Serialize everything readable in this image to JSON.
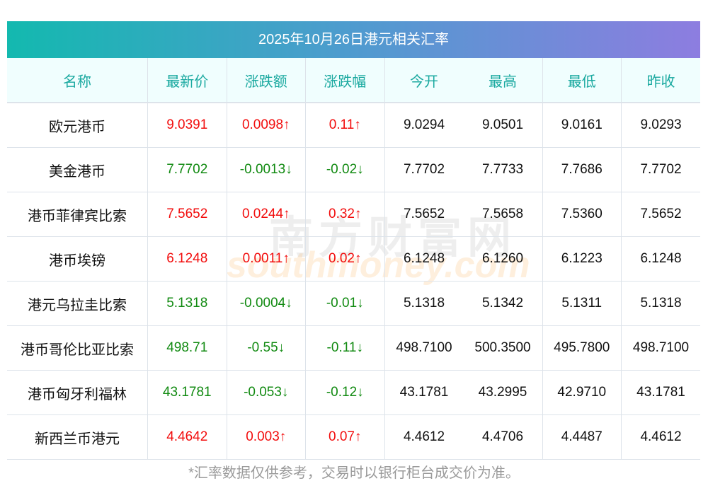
{
  "title": "2025年10月26日港元相关汇率",
  "headers": [
    "名称",
    "最新价",
    "涨跌额",
    "涨跌幅",
    "今开",
    "最高",
    "最低",
    "昨收"
  ],
  "rows": [
    {
      "name": "欧元港币",
      "latest": "9.0391",
      "change": "0.0098↑",
      "pct": "0.11↑",
      "open": "9.0294",
      "high": "9.0501",
      "low": "9.0161",
      "prev": "9.0293",
      "dir": "up"
    },
    {
      "name": "美金港币",
      "latest": "7.7702",
      "change": "-0.0013↓",
      "pct": "-0.02↓",
      "open": "7.7702",
      "high": "7.7733",
      "low": "7.7686",
      "prev": "7.7702",
      "dir": "down"
    },
    {
      "name": "港币菲律宾比索",
      "latest": "7.5652",
      "change": "0.0244↑",
      "pct": "0.32↑",
      "open": "7.5652",
      "high": "7.5658",
      "low": "7.5360",
      "prev": "7.5652",
      "dir": "up"
    },
    {
      "name": "港币埃镑",
      "latest": "6.1248",
      "change": "0.0011↑",
      "pct": "0.02↑",
      "open": "6.1248",
      "high": "6.1260",
      "low": "6.1223",
      "prev": "6.1248",
      "dir": "up"
    },
    {
      "name": "港元乌拉圭比索",
      "latest": "5.1318",
      "change": "-0.0004↓",
      "pct": "-0.01↓",
      "open": "5.1318",
      "high": "5.1342",
      "low": "5.1311",
      "prev": "5.1318",
      "dir": "down"
    },
    {
      "name": "港币哥伦比亚比索",
      "latest": "498.71",
      "change": "-0.55↓",
      "pct": "-0.11↓",
      "open": "498.7100",
      "high": "500.3500",
      "low": "495.7800",
      "prev": "498.7100",
      "dir": "down"
    },
    {
      "name": "港币匈牙利福林",
      "latest": "43.1781",
      "change": "-0.053↓",
      "pct": "-0.12↓",
      "open": "43.1781",
      "high": "43.2995",
      "low": "42.9710",
      "prev": "43.1781",
      "dir": "down"
    },
    {
      "name": "新西兰币港元",
      "latest": "4.4642",
      "change": "0.003↑",
      "pct": "0.07↑",
      "open": "4.4612",
      "high": "4.4706",
      "low": "4.4487",
      "prev": "4.4612",
      "dir": "up"
    }
  ],
  "watermark": {
    "cn": "南方财富网",
    "en": "southmoney.com"
  },
  "footer": "*汇率数据仅供参考，交易时以银行柜台成交价为准。"
}
